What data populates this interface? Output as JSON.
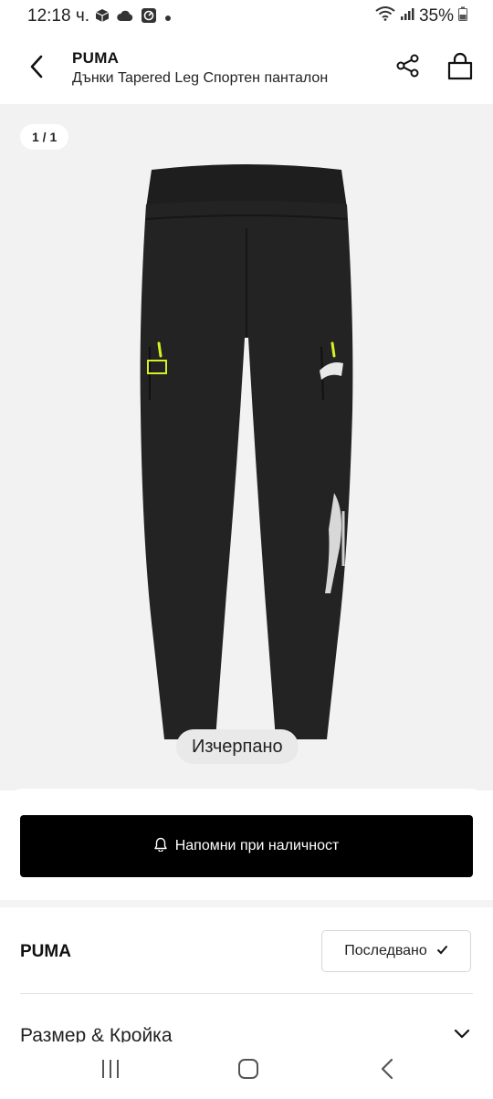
{
  "status_bar": {
    "time": "12:18 ч.",
    "battery": "35%",
    "icons": [
      "box-icon",
      "cloud-icon",
      "screen-icon",
      "dot-icon",
      "wifi-icon",
      "signal-icon",
      "battery-icon"
    ]
  },
  "header": {
    "brand": "PUMA",
    "title": "Дънки Tapered Leg Спортен панталон",
    "icons": [
      "back-icon",
      "share-icon",
      "bag-icon"
    ]
  },
  "gallery": {
    "counter": "1 / 1",
    "badge": "Изчерпано",
    "colors": {
      "background": "#f2f2f2",
      "accent": "#d7f023"
    }
  },
  "actions": {
    "notify_label": "Напомни при наличност",
    "notify_icon": "bell-icon"
  },
  "brand_row": {
    "name": "PUMA",
    "follow_label": "Последвано",
    "follow_icon": "check-icon"
  },
  "accordion": {
    "label": "Размер & Кройка",
    "icon": "chevron-down-icon"
  },
  "nav_bar": {
    "icons": [
      "recent-apps-icon",
      "home-icon",
      "back-nav-icon"
    ]
  }
}
